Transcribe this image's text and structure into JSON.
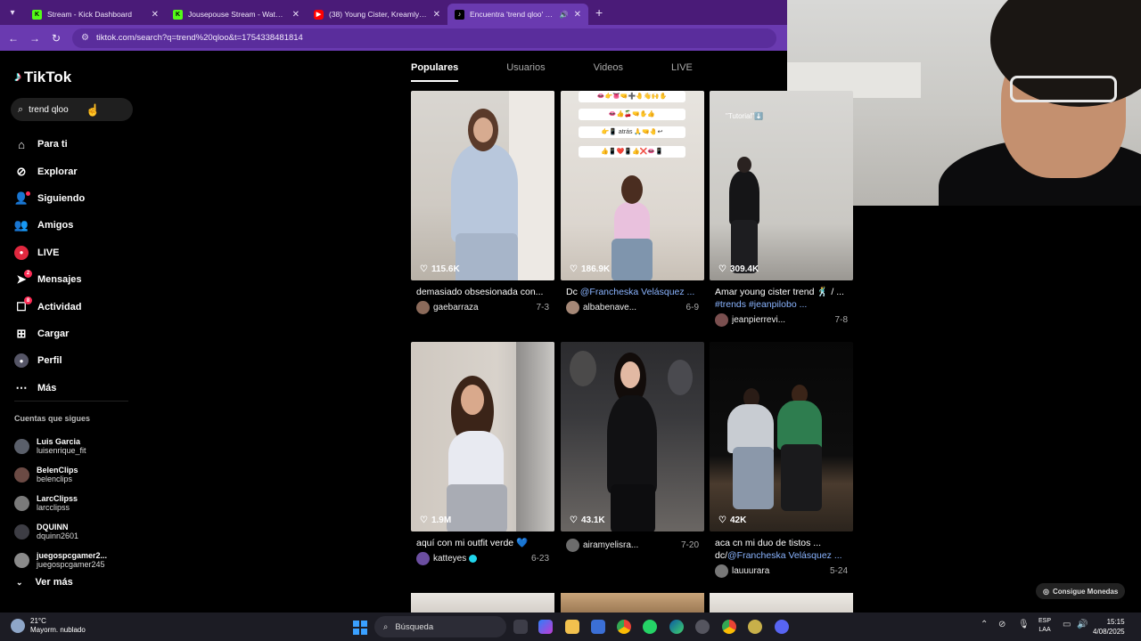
{
  "browser": {
    "tabs": [
      {
        "title": "Stream - Kick Dashboard",
        "favicon": "kick-icon",
        "color": "#53fc18",
        "glyph": "K"
      },
      {
        "title": "Jousepouse Stream - Watch Liv",
        "favicon": "kick-icon",
        "color": "#53fc18",
        "glyph": "K"
      },
      {
        "title": "(38) Young Cister, Kreamly - Qu",
        "favicon": "youtube-icon",
        "color": "#ff0000",
        "glyph": "▶"
      },
      {
        "title": "Encuentra 'trend qloo' en T",
        "favicon": "tiktok-icon",
        "color": "#000000",
        "glyph": "♪"
      }
    ],
    "url": "tiktok.com/search?q=trend%20qloo&t=1754338481814"
  },
  "sidebar": {
    "logo": "TikTok",
    "search_value": "trend qloo",
    "nav": [
      {
        "label": "Para ti",
        "icon": "home-icon"
      },
      {
        "label": "Explorar",
        "icon": "compass-icon"
      },
      {
        "label": "Siguiendo",
        "icon": "following-icon"
      },
      {
        "label": "Amigos",
        "icon": "friends-icon"
      },
      {
        "label": "LIVE",
        "icon": "live-icon"
      },
      {
        "label": "Mensajes",
        "icon": "messages-icon",
        "badge": "2"
      },
      {
        "label": "Actividad",
        "icon": "activity-icon",
        "badge": "8"
      },
      {
        "label": "Cargar",
        "icon": "upload-icon"
      },
      {
        "label": "Perfil",
        "icon": "profile-icon"
      },
      {
        "label": "Más",
        "icon": "more-icon"
      }
    ],
    "following_title": "Cuentas que sigues",
    "following": [
      {
        "name": "Luis Garcia",
        "user": "luisenrique_fit"
      },
      {
        "name": "BelenClips",
        "user": "belenclips"
      },
      {
        "name": "LarcClipss",
        "user": "larcclipss"
      },
      {
        "name": "DQUINN",
        "user": "dquinn2601"
      },
      {
        "name": "juegospcgamer2...",
        "user": "juegospcgamer245"
      }
    ],
    "see_more": "Ver más"
  },
  "content_tabs": [
    "Populares",
    "Usuarios",
    "Videos",
    "LIVE"
  ],
  "videos": [
    {
      "likes": "115.6K",
      "desc": "demasiado obsesionada con...",
      "user": "gaebarraza",
      "date": "7-3"
    },
    {
      "likes": "186.9K",
      "desc_prefix": "Dc ",
      "desc_mention": "@Francheska Velásquez ...",
      "user": "albabenave...",
      "date": "6-9"
    },
    {
      "likes": "309.4K",
      "desc": "Amar young cister trend 🕺 / ...",
      "desc_tags": "#trends #jeanpilobo ...",
      "user": "jeanpierrevi...",
      "date": "7-8"
    },
    {
      "likes": "1.9M",
      "desc": "aquí con mi outfit verde 💙",
      "user": "katteyes",
      "date": "6-23"
    },
    {
      "likes": "43.1K",
      "desc": "",
      "user": "airamyelisra...",
      "date": "7-20"
    },
    {
      "likes": "42K",
      "desc": "aca cn mi duo de tistos ...",
      "desc_prefix2": "dc/",
      "desc_mention2": "@Francheska Velásquez ...",
      "user": "lauuurara",
      "date": "5-24"
    }
  ],
  "thumb_text": {
    "v2_emoji_rows": [
      "👄👉👅🤜➕🤚👋🙌✋",
      "👄👍🍒🤜✋👍",
      "👉📱 atrás 🙏🤜🤚↩",
      "👍📱❤️📱👍❌👄📱"
    ],
    "v3_overlay": "\"Tutorial\"⬇️"
  },
  "coins_label": "Consigue Monedas",
  "taskbar": {
    "temp": "21°C",
    "weather": "Mayorm. nublado",
    "search": "Búsqueda",
    "lang1": "ESP",
    "lang2": "LAA",
    "time": "15:15",
    "date": "4/08/2025"
  }
}
